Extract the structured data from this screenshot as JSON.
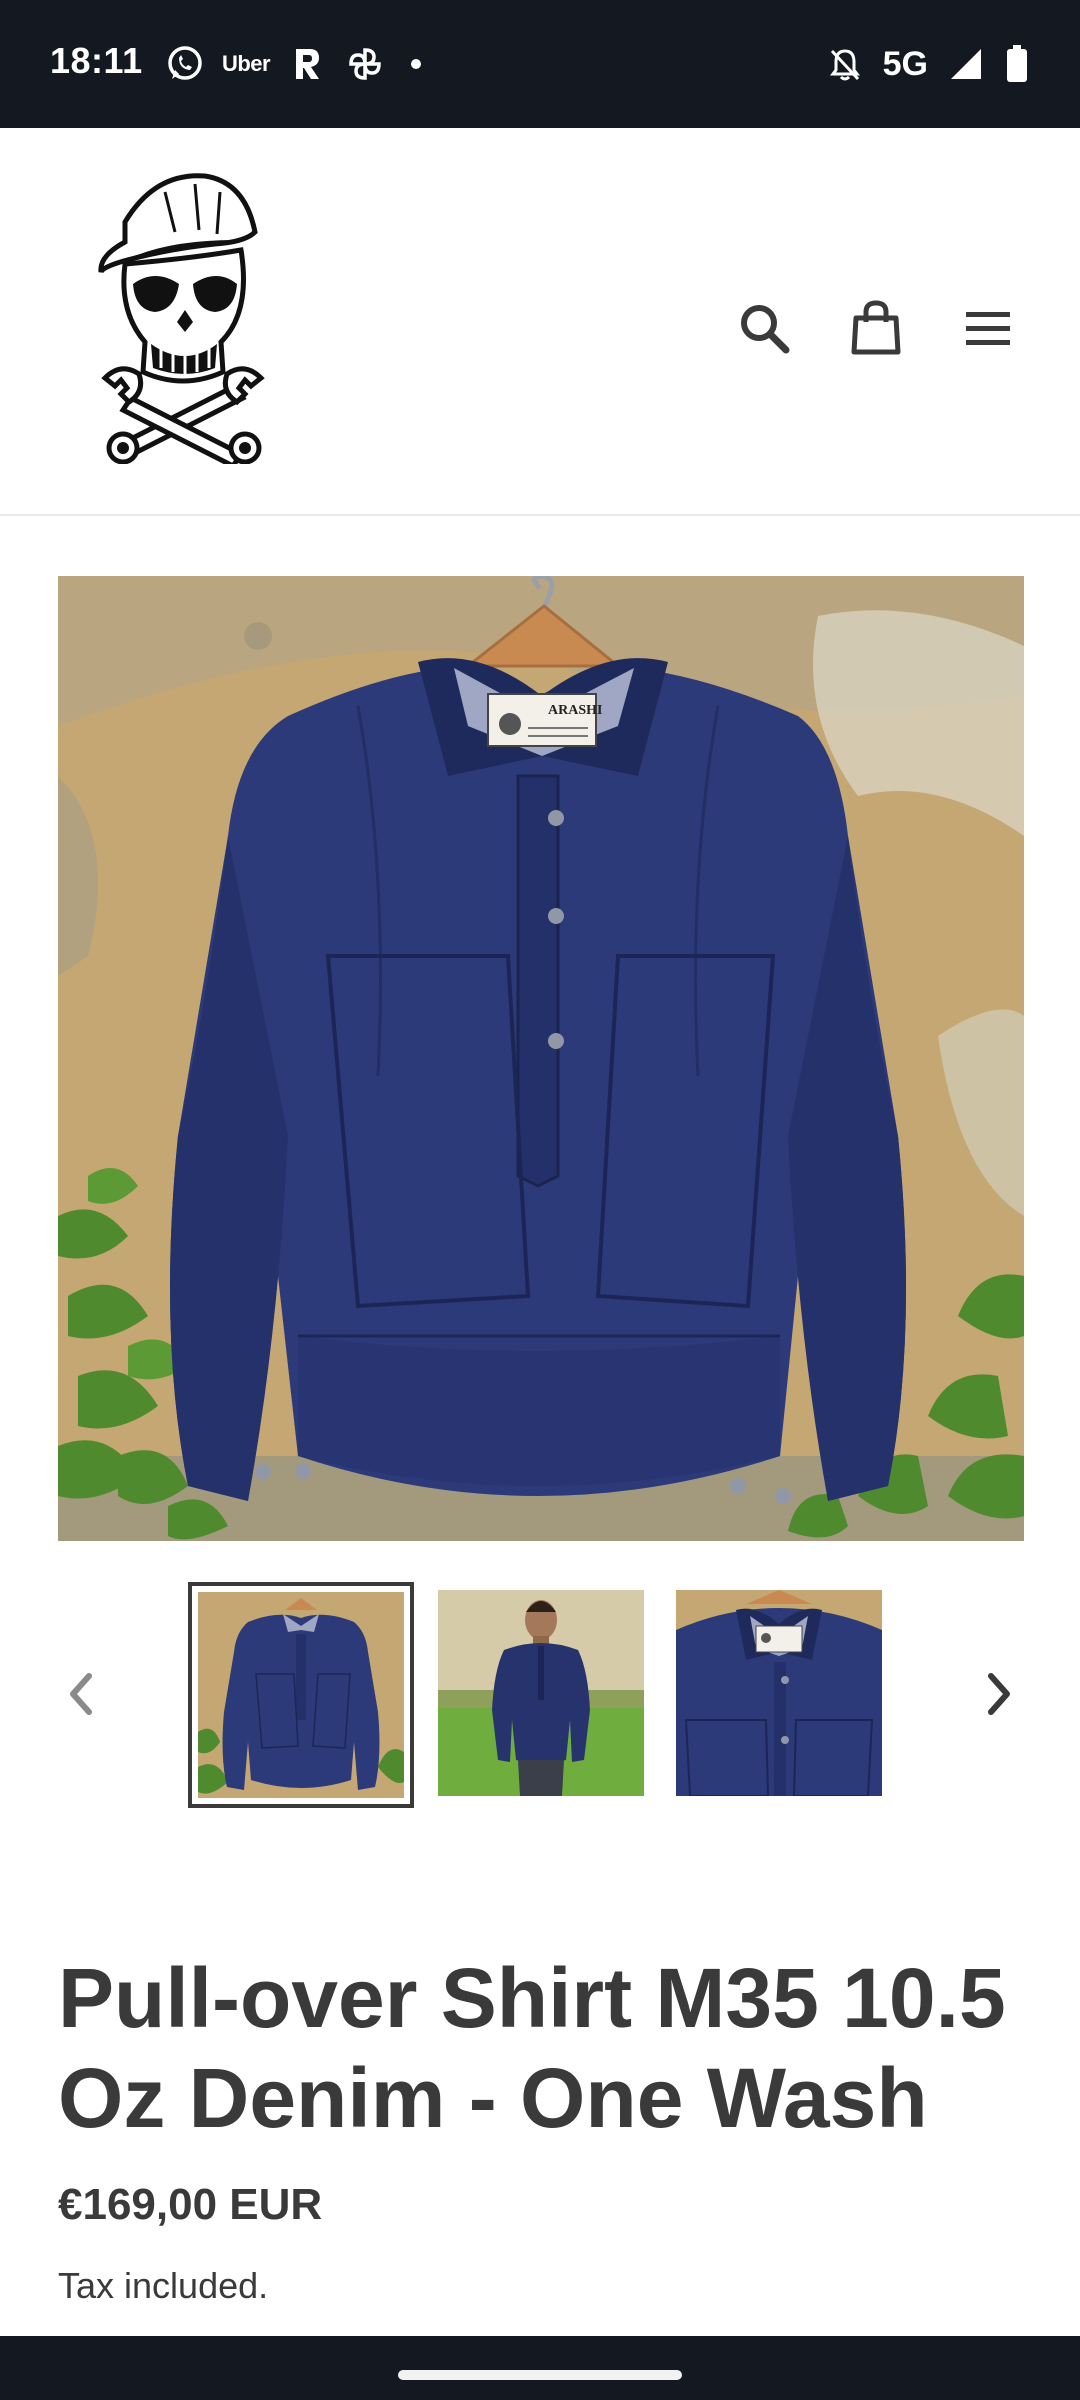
{
  "status_bar": {
    "time": "18:11",
    "left_icons": [
      "whatsapp-icon",
      "uber-icon",
      "r-app-icon",
      "pinwheel-icon",
      "notification-dot"
    ],
    "uber_label": "Uber",
    "network": "5G",
    "right_icons": [
      "bell-off-icon",
      "signal-icon",
      "battery-icon"
    ]
  },
  "header": {
    "logo_name": "skull-mechanic-logo",
    "icons": [
      "search-icon",
      "cart-icon",
      "menu-icon"
    ]
  },
  "product": {
    "title": "Pull-over Shirt M35 10.5 Oz Denim - One Wash",
    "price": "€169,00 EUR",
    "tax_note": "Tax included.",
    "label_text": "ARASHI",
    "thumbnails": [
      {
        "name": "thumb-front-hanger",
        "selected": true
      },
      {
        "name": "thumb-model-wearing",
        "selected": false
      },
      {
        "name": "thumb-collar-detail",
        "selected": false
      }
    ]
  },
  "colors": {
    "denim": "#2c3a7a",
    "denim_dark": "#1f2a5c",
    "wall": "#c2a46e",
    "leaf": "#4f8a2e",
    "text": "#3a3a3a",
    "bar": "#141821"
  }
}
